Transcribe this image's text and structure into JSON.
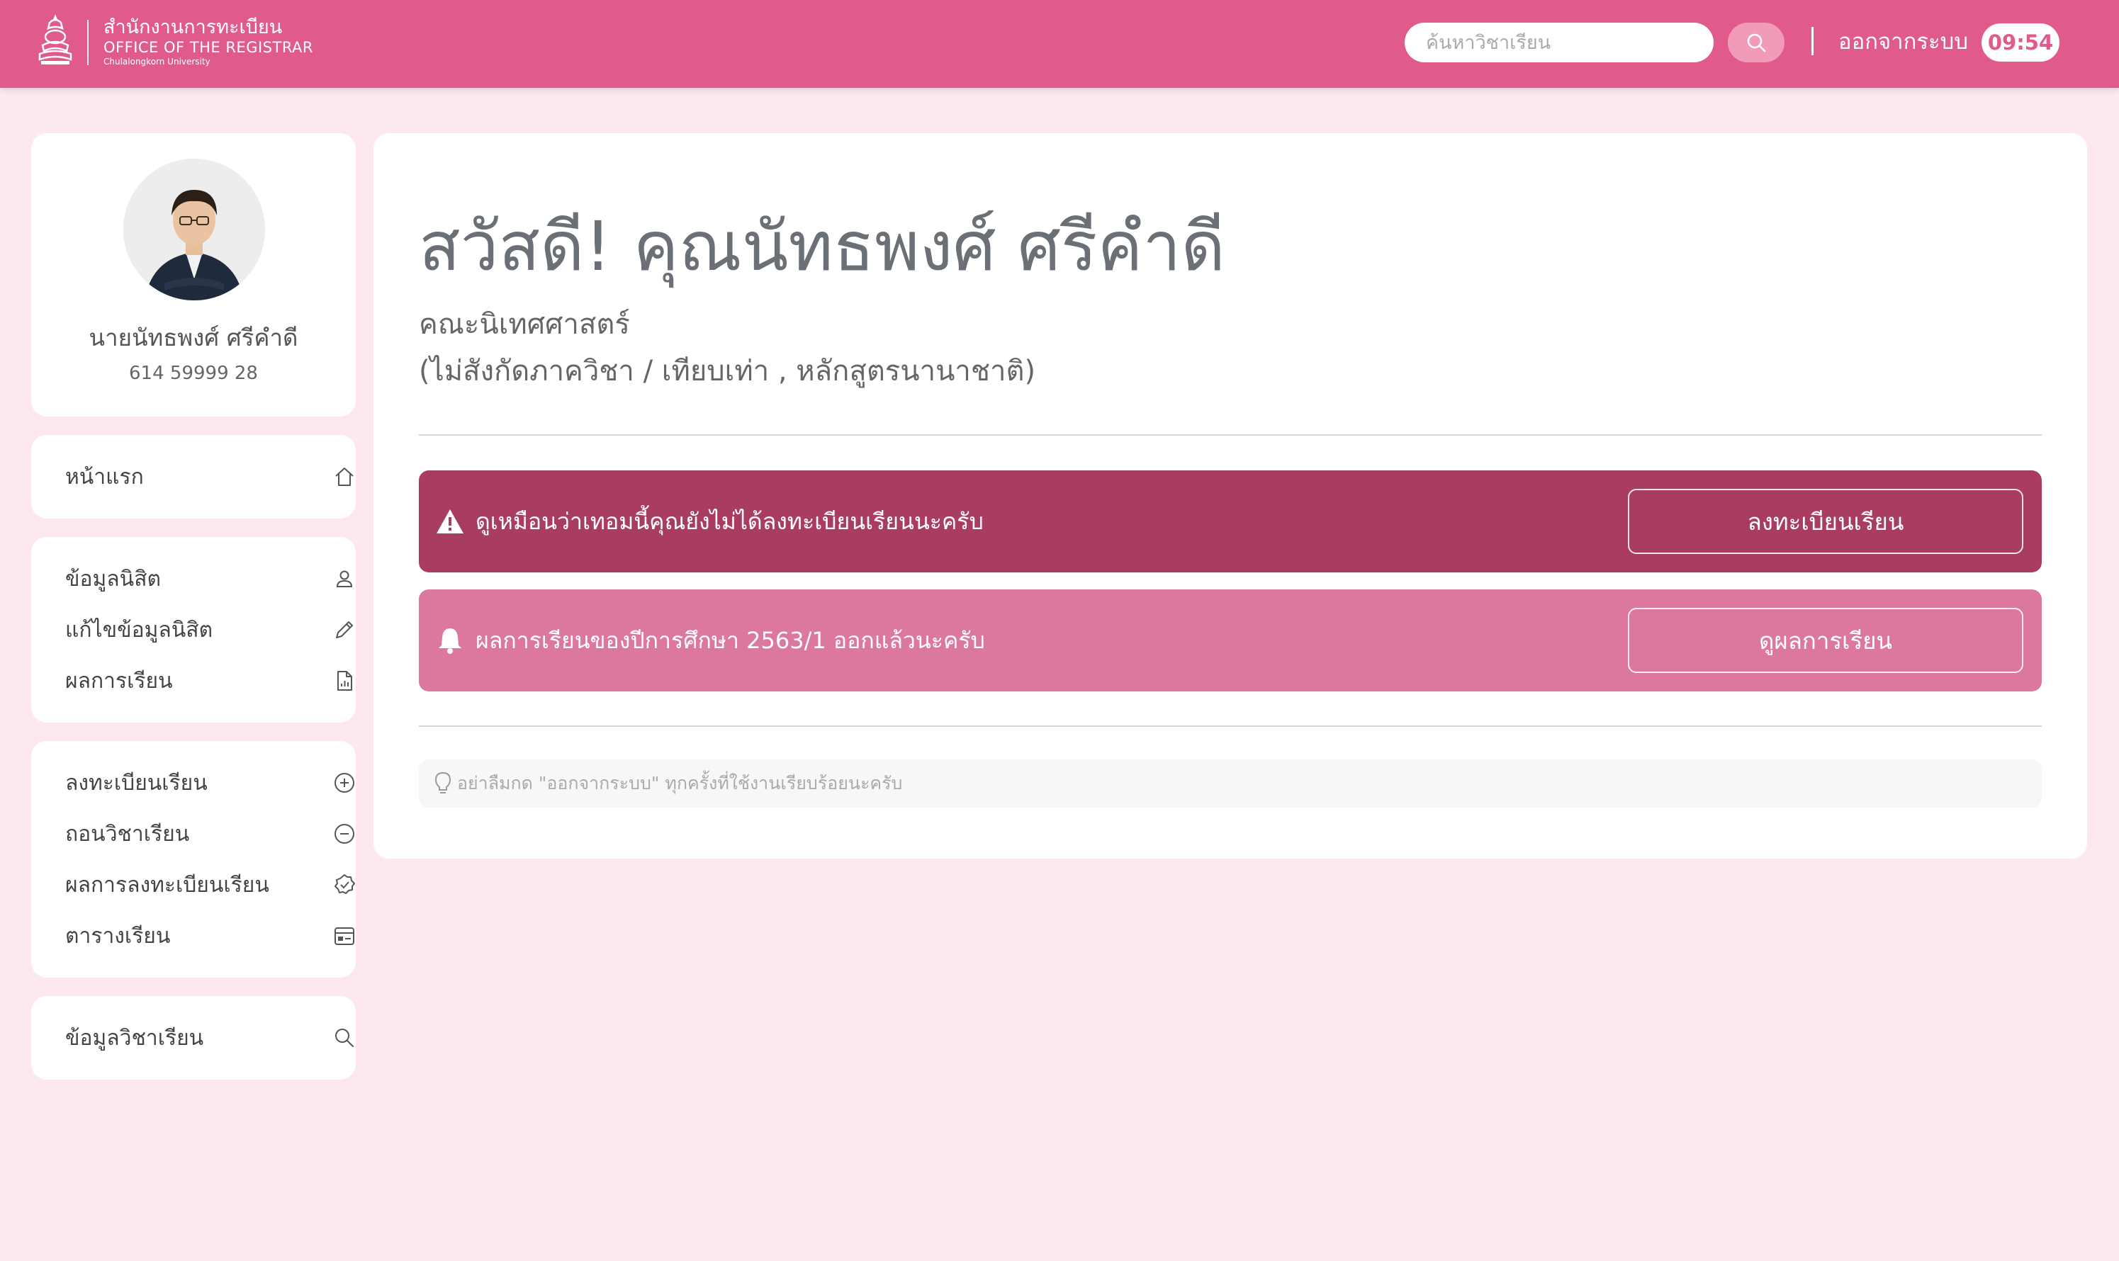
{
  "header": {
    "logo_th": "สำนักงานการทะเบียน",
    "logo_en": "OFFICE OF THE REGISTRAR",
    "logo_sub": "Chulalongkorn University",
    "search_placeholder": "ค้นหาวิชาเรียน",
    "logout_label": "ออกจากระบบ",
    "timer": "09:54",
    "brand_color": "#e05a8c"
  },
  "profile": {
    "name": "นายนัทธพงศ์ ศรีคำดี",
    "student_id": "614 59999 28"
  },
  "sidebar": {
    "home": "หน้าแรก",
    "student_info": "ข้อมูลนิสิต",
    "edit_info": "แก้ไขข้อมูลนิสิต",
    "grades": "ผลการเรียน",
    "register": "ลงทะเบียนเรียน",
    "withdraw": "ถอนวิชาเรียน",
    "register_result": "ผลการลงทะเบียนเรียน",
    "timetable": "ตารางเรียน",
    "course_info": "ข้อมูลวิชาเรียน"
  },
  "main": {
    "greeting": "สวัสดี! คุณนัทธพงศ์ ศรีคำดี",
    "faculty": "คณะนิเทศศาสตร์",
    "program": "(ไม่สังกัดภาควิชา / เทียบเท่า , หลักสูตรนานาชาติ)",
    "alert_text": "ดูเหมือนว่าเทอมนี้คุณยังไม่ได้ลงทะเบียนเรียนนะครับ",
    "alert_button": "ลงทะเบียนเรียน",
    "info_text": "ผลการเรียนของปีการศึกษา 2563/1 ออกแล้วนะครับ",
    "info_button": "ดูผลการเรียน",
    "tip_text": "อย่าลืมกด \"ออกจากระบบ\" ทุกครั้งที่ใช้งานเรียบร้อยนะครับ"
  }
}
